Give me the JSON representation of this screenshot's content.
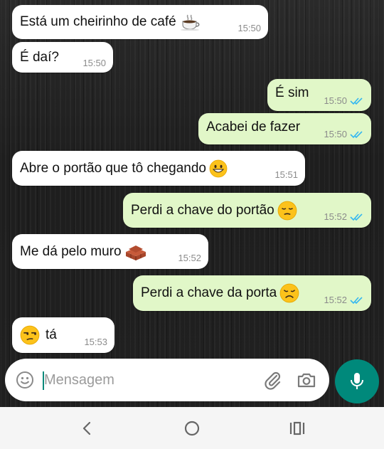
{
  "messages": [
    {
      "direction": "in",
      "text": "Está um cheirinho de café",
      "emoji": "coffee-icon",
      "time": "15:50"
    },
    {
      "direction": "in",
      "text": "É daí?",
      "time": "15:50"
    },
    {
      "direction": "out",
      "text": "É sim",
      "time": "15:50",
      "status": "read"
    },
    {
      "direction": "out",
      "text": "Acabei de fazer",
      "time": "15:50",
      "status": "read"
    },
    {
      "direction": "in",
      "text": "Abre o portão que tô chegando",
      "emoji": "grinning-face-icon",
      "time": "15:51"
    },
    {
      "direction": "out",
      "text": "Perdi a chave do portão",
      "emoji": "pensive-face-icon",
      "time": "15:52",
      "status": "read"
    },
    {
      "direction": "in",
      "text": "Me dá pelo muro",
      "emoji": "bricks-icon",
      "time": "15:52"
    },
    {
      "direction": "out",
      "text": "Perdi a chave da porta",
      "emoji": "disappointed-face-icon",
      "time": "15:52",
      "status": "read"
    },
    {
      "direction": "in",
      "text": "tá",
      "emoji_before": "unamused-face-icon",
      "time": "15:53"
    }
  ],
  "composer": {
    "placeholder": "Mensagem",
    "value": ""
  },
  "colors": {
    "incoming_bubble": "#ffffff",
    "outgoing_bubble": "#e1f7c8",
    "read_ticks": "#34b7f1",
    "accent": "#00897b"
  },
  "icons": {
    "composer": [
      "emoji-icon",
      "attach-clip-icon",
      "camera-icon",
      "mic-icon"
    ],
    "navigation": [
      "back-icon",
      "home-icon",
      "recent-apps-icon"
    ]
  }
}
